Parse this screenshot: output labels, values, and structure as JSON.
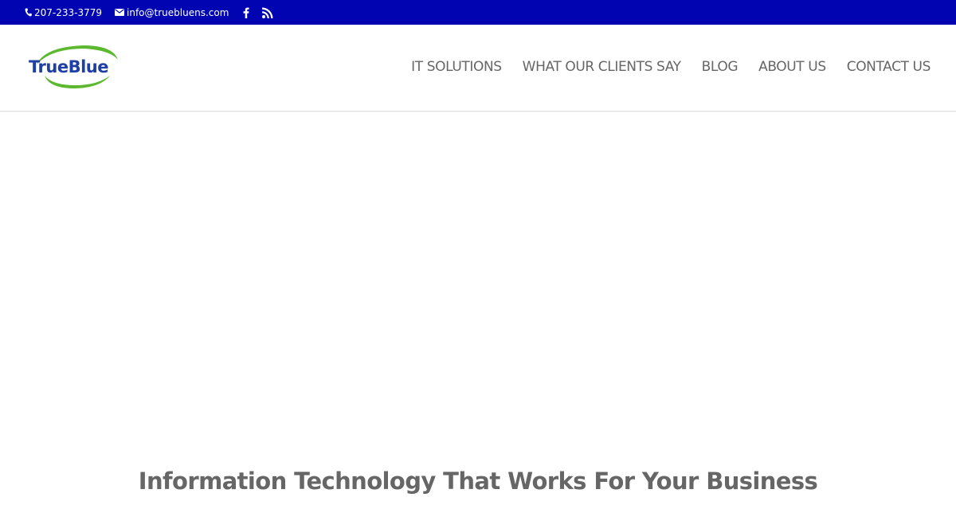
{
  "top_bar": {
    "phone": "207-233-3779",
    "email": "info@truebluens.com",
    "icons": {
      "phone": "phone-icon",
      "email": "envelope-icon",
      "facebook": "facebook-icon",
      "rss": "rss-icon"
    },
    "background_color": "#0005b1"
  },
  "header": {
    "logo_text": "TrueBlue",
    "logo_colors": {
      "text": "#1f3fa6",
      "swoosh": "#5cb82e"
    },
    "nav": [
      {
        "label": "IT SOLUTIONS"
      },
      {
        "label": "WHAT OUR CLIENTS SAY"
      },
      {
        "label": "BLOG"
      },
      {
        "label": "ABOUT US"
      },
      {
        "label": "CONTACT US"
      }
    ]
  },
  "hero": {
    "title": "Information Technology That Works For Your Business"
  }
}
